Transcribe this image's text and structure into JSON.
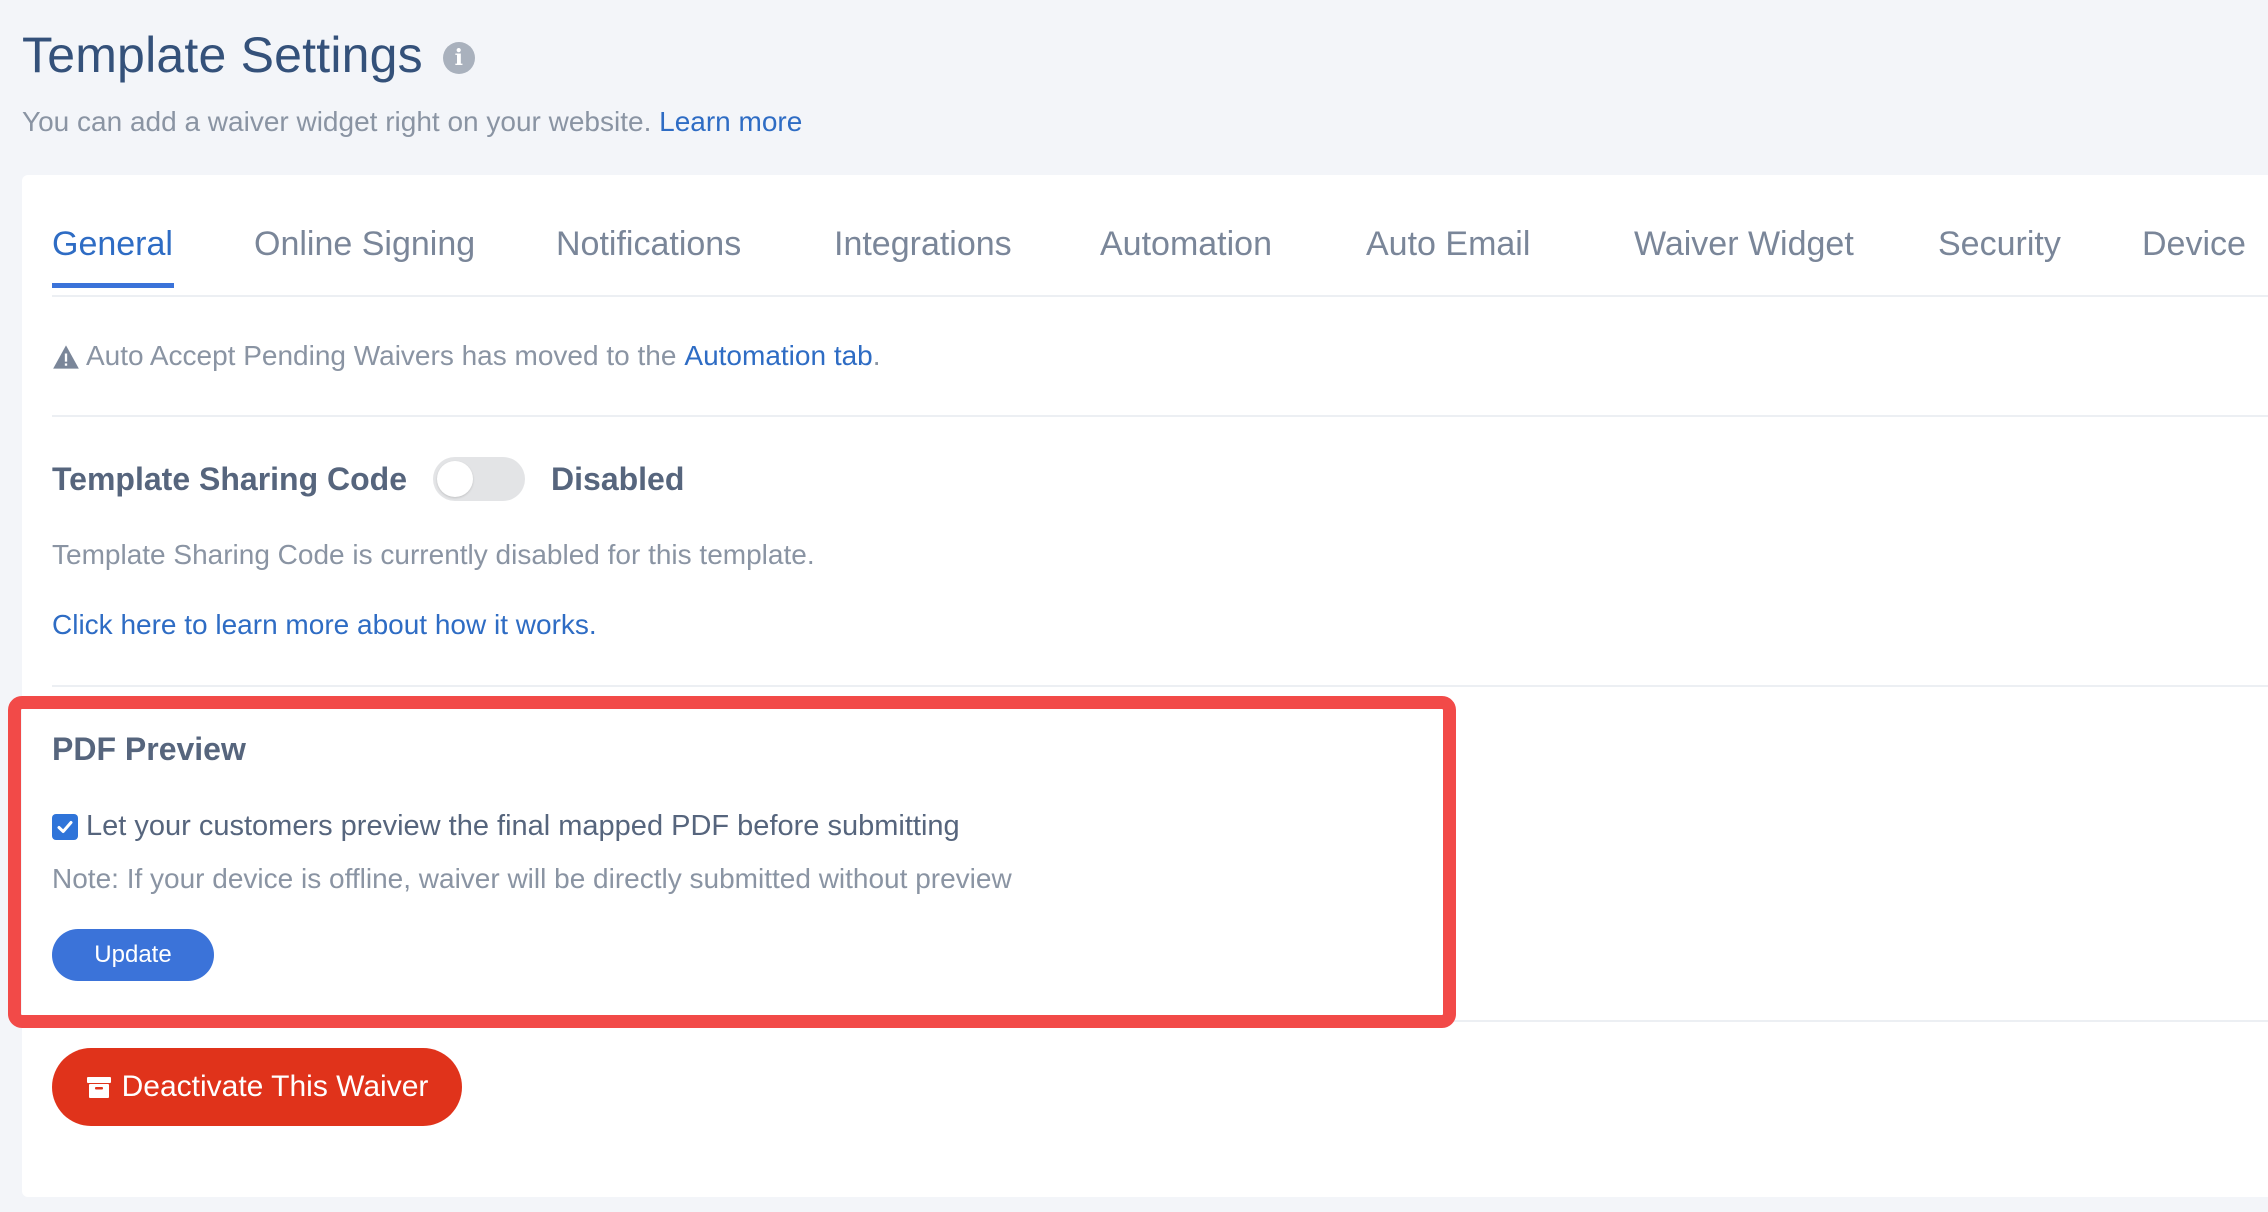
{
  "header": {
    "title": "Template Settings",
    "subtitle": "You can add a waiver widget right on your website.",
    "learn_more": "Learn more"
  },
  "tabs": [
    {
      "label": "General",
      "active": true
    },
    {
      "label": "Online Signing",
      "active": false
    },
    {
      "label": "Notifications",
      "active": false
    },
    {
      "label": "Integrations",
      "active": false
    },
    {
      "label": "Automation",
      "active": false
    },
    {
      "label": "Auto Email",
      "active": false
    },
    {
      "label": "Waiver Widget",
      "active": false
    },
    {
      "label": "Security",
      "active": false
    },
    {
      "label": "Device",
      "active": false
    }
  ],
  "notice": {
    "text": "Auto Accept Pending Waivers has moved to the",
    "link": "Automation tab",
    "suffix": "."
  },
  "sharing": {
    "title": "Template Sharing Code",
    "toggle_on": false,
    "state_label": "Disabled",
    "description": "Template Sharing Code is currently disabled for this template.",
    "link": "Click here to learn more about how it works."
  },
  "pdf_preview": {
    "title": "PDF Preview",
    "checkbox_checked": true,
    "checkbox_label": "Let your customers preview the final mapped PDF before submitting",
    "note": "Note: If your device is offline, waiver will be directly submitted without preview",
    "update_label": "Update"
  },
  "deactivate": {
    "label": "Deactivate This Waiver",
    "icon": "archive-icon"
  },
  "colors": {
    "accent": "#3b73d9",
    "link": "#2e6cc4",
    "danger": "#e0331b",
    "highlight": "#f24a48",
    "background": "#f3f5f9"
  }
}
